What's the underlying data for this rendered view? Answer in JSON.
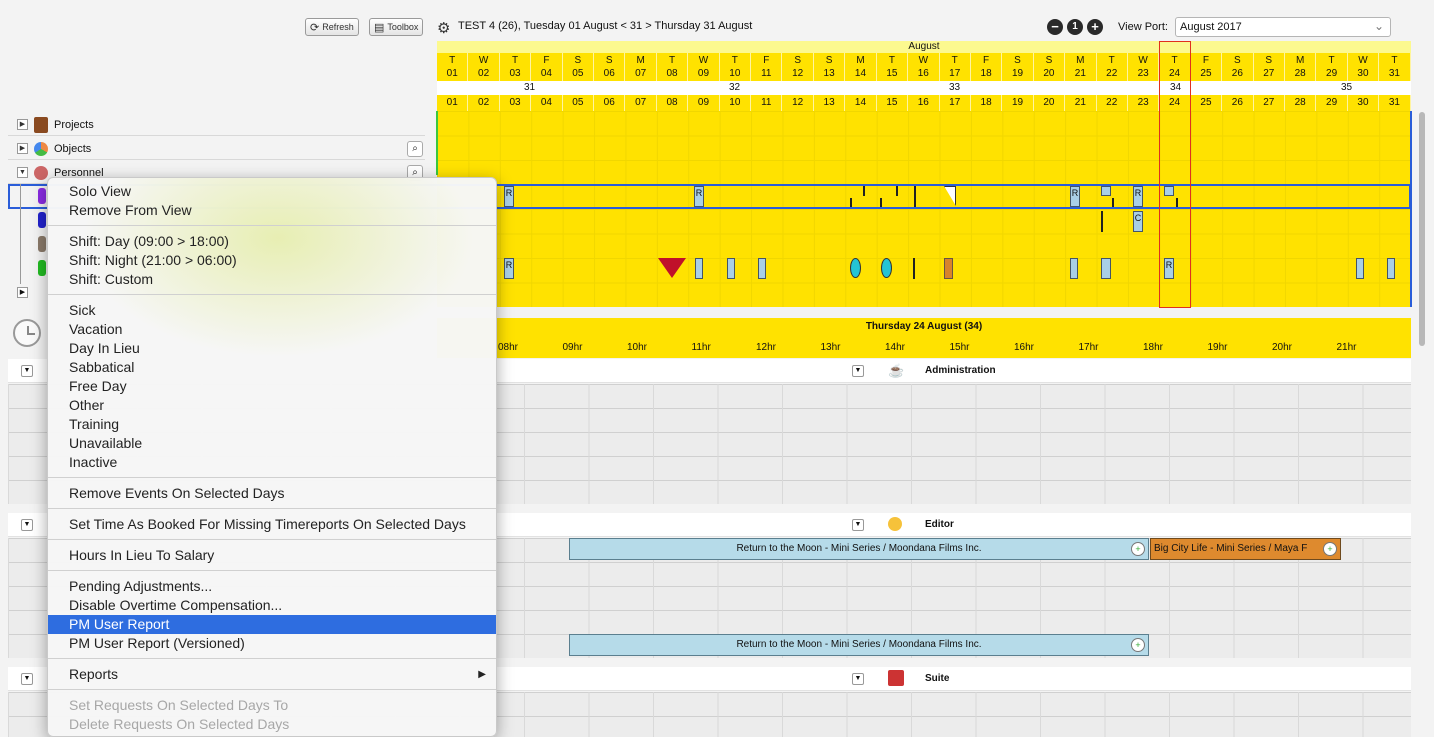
{
  "toolbar": {
    "refresh_label": "Refresh",
    "toolbox_label": "Toolbox",
    "header_text": "TEST 4 (26),  Tuesday 01 August < 31 > Thursday 31 August",
    "viewport_label": "View Port:",
    "viewport_value": "August 2017"
  },
  "calendar": {
    "month": "August",
    "day_letters": [
      "T",
      "W",
      "T",
      "F",
      "S",
      "S",
      "M",
      "T",
      "W",
      "T",
      "F",
      "S",
      "S",
      "M",
      "T",
      "W",
      "T",
      "F",
      "S",
      "S",
      "M",
      "T",
      "W",
      "T",
      "F",
      "S",
      "S",
      "M",
      "T",
      "W",
      "T"
    ],
    "day_numbers": [
      "01",
      "02",
      "03",
      "04",
      "05",
      "06",
      "07",
      "08",
      "09",
      "10",
      "11",
      "12",
      "13",
      "14",
      "15",
      "16",
      "17",
      "18",
      "19",
      "20",
      "21",
      "22",
      "23",
      "24",
      "25",
      "26",
      "27",
      "28",
      "29",
      "30",
      "31"
    ],
    "weeks": [
      "31",
      "32",
      "33",
      "34",
      "35"
    ]
  },
  "tree": {
    "projects": "Projects",
    "objects": "Objects",
    "personnel": "Personnel"
  },
  "day_view": {
    "title": "Thursday 24 August (34)",
    "hours": [
      "08hr",
      "09hr",
      "10hr",
      "11hr",
      "12hr",
      "13hr",
      "14hr",
      "15hr",
      "16hr",
      "17hr",
      "18hr",
      "19hr",
      "20hr",
      "21hr"
    ],
    "groups": {
      "administration": "Administration",
      "editor": "Editor",
      "suite": "Suite"
    },
    "bars": {
      "moon1": "Return to the Moon - Mini Series / Moondana Films Inc.",
      "bigcity": "Big City Life - Mini Series / Maya F",
      "moon2": "Return to the Moon - Mini Series / Moondana Films Inc."
    },
    "event_letters": {
      "r": "R",
      "c": "C"
    }
  },
  "menu": {
    "items": [
      "Solo View",
      "Remove From View",
      "Shift: Day (09:00 > 18:00)",
      "Shift: Night (21:00 > 06:00)",
      "Shift: Custom",
      "Sick",
      "Vacation",
      "Day In Lieu",
      "Sabbatical",
      "Free Day",
      "Other",
      "Training",
      "Unavailable",
      "Inactive",
      "Remove Events On Selected Days",
      "Set Time As Booked For Missing Timereports On Selected Days",
      "Hours In Lieu To Salary",
      "Pending Adjustments...",
      "Disable Overtime Compensation...",
      "PM User Report",
      "PM User Report (Versioned)",
      "Reports",
      "Set Requests On Selected Days To",
      "Delete Requests On Selected Days"
    ],
    "selected_item": "PM User Report"
  }
}
